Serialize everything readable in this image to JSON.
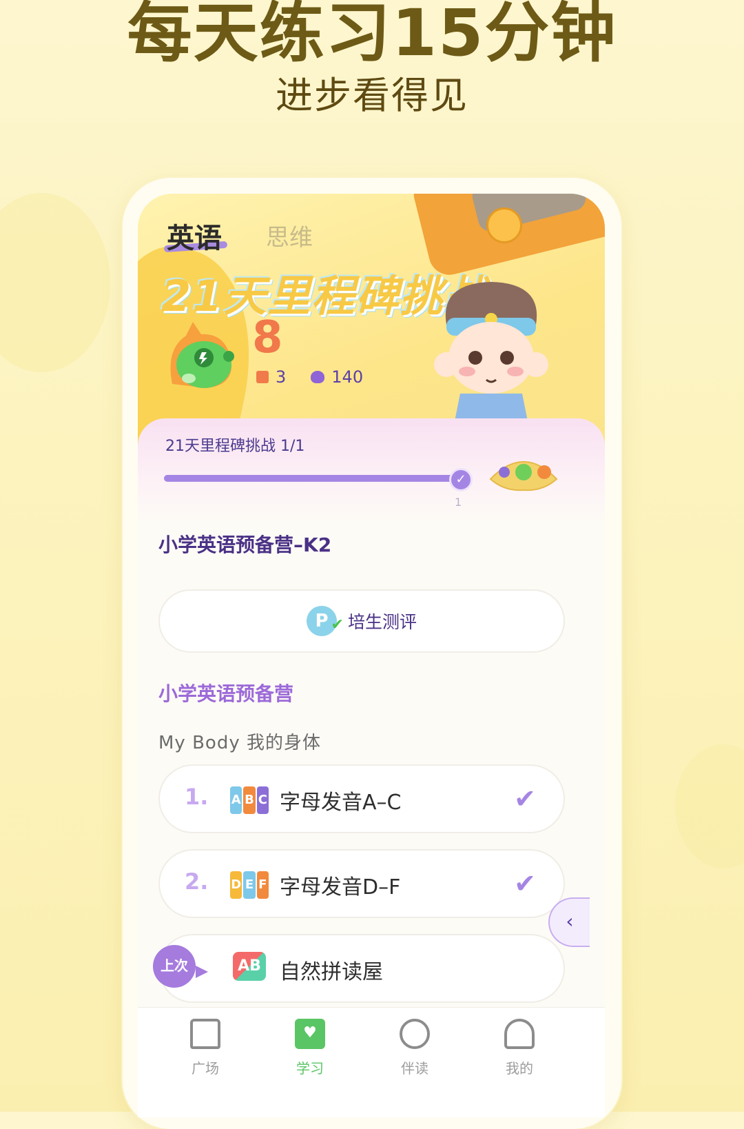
{
  "promo": {
    "headline": "每天练习15分钟",
    "subline": "进步看得见"
  },
  "header": {
    "tabs": [
      {
        "label": "英语",
        "active": true
      },
      {
        "label": "思维",
        "active": false
      }
    ],
    "challenge_title": "21天里程碑挑战",
    "streak_days": "8",
    "badges_count": "3",
    "gems_count": "140"
  },
  "progress": {
    "label": "21天里程碑挑战",
    "count": "1/1",
    "fraction": 1.0,
    "milestone_tick": "1"
  },
  "course": {
    "title": "小学英语预备营–K2",
    "assessment_label": "培生测评",
    "assessment_icon": "pearson-check-icon"
  },
  "camp": {
    "title": "小学英语预备营",
    "unit_title": "My Body 我的身体"
  },
  "lessons": [
    {
      "num": "1.",
      "letters": [
        "A",
        "B",
        "C"
      ],
      "name": "字母发音A–C",
      "done": true
    },
    {
      "num": "2.",
      "letters": [
        "D",
        "E",
        "F"
      ],
      "name": "字母发音D–F",
      "done": true
    },
    {
      "num": "",
      "letters": [
        "A",
        "B"
      ],
      "name": "自然拼读屋",
      "done": false
    }
  ],
  "last_badge": "上次",
  "collapse_icon": "chevron-left-icon",
  "tabbar": [
    {
      "label": "广场",
      "icon": "home-icon",
      "active": false
    },
    {
      "label": "学习",
      "icon": "book-heart-icon",
      "active": true
    },
    {
      "label": "伴读",
      "icon": "planet-icon",
      "active": false
    },
    {
      "label": "我的",
      "icon": "bell-icon",
      "active": false
    }
  ],
  "colors": {
    "accent": "#a585e4",
    "active_tab": "#5ac565",
    "streak": "#f0784a"
  }
}
